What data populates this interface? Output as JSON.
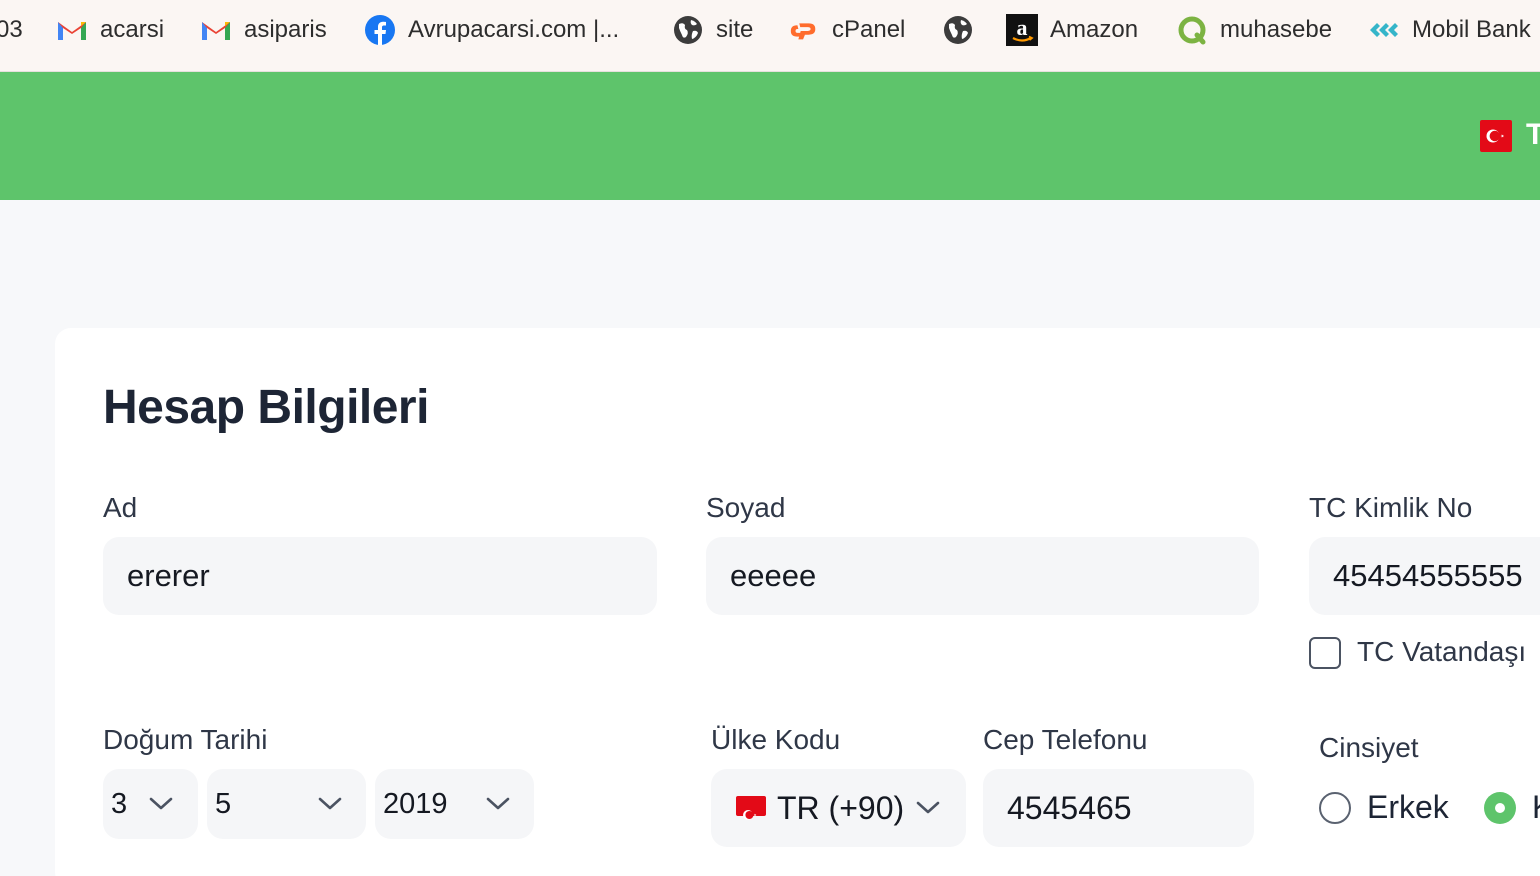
{
  "bookmarks": [
    {
      "label": "03",
      "icon": "partial"
    },
    {
      "label": "acarsi",
      "icon": "gmail-icon"
    },
    {
      "label": "asiparis",
      "icon": "gmail-icon"
    },
    {
      "label": "Avrupacarsi.com |...",
      "icon": "facebook-icon"
    },
    {
      "label": "site",
      "icon": "globe-icon"
    },
    {
      "label": "cPanel",
      "icon": "cpanel-icon"
    },
    {
      "label": "",
      "icon": "globe-icon"
    },
    {
      "label": "Amazon",
      "icon": "amazon-icon"
    },
    {
      "label": "muhasebe",
      "icon": "muhasebe-icon"
    },
    {
      "label": "Mobil Bank",
      "icon": "mobil-bank-icon"
    }
  ],
  "header": {
    "language_partial": "T",
    "colors": {
      "green": "#5ec46b",
      "flag_red": "#e30a17"
    }
  },
  "form": {
    "title": "Hesap Bilgileri",
    "first_name": {
      "label": "Ad",
      "value": "ererer"
    },
    "last_name": {
      "label": "Soyad",
      "value": "eeeee"
    },
    "tc_no": {
      "label": "TC Kimlik No",
      "value": "45454555555"
    },
    "tc_citizen": {
      "label": "TC Vatandaşı",
      "checked": false
    },
    "birth_date": {
      "label": "Doğum Tarihi",
      "day": "3",
      "month": "5",
      "year": "2019"
    },
    "country_code": {
      "label": "Ülke Kodu",
      "value": "TR (+90)"
    },
    "phone": {
      "label": "Cep Telefonu",
      "value": "4545465"
    },
    "gender": {
      "label": "Cinsiyet",
      "options": [
        "Erkek",
        "K"
      ],
      "selected": "K"
    }
  }
}
